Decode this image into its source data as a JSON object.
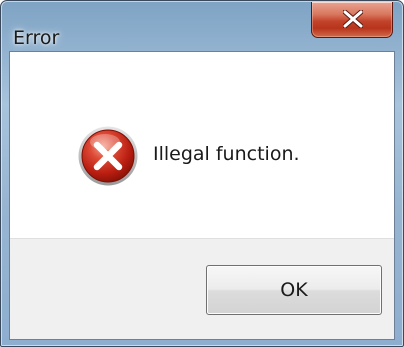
{
  "dialog": {
    "title": "Error",
    "message": "Illegal function.",
    "ok_label": "OK",
    "close_icon": "close-icon",
    "error_icon": "error-icon",
    "colors": {
      "close_button": "#c7432a",
      "error_icon": "#c4271b",
      "button_area": "#f0f0f0"
    }
  }
}
